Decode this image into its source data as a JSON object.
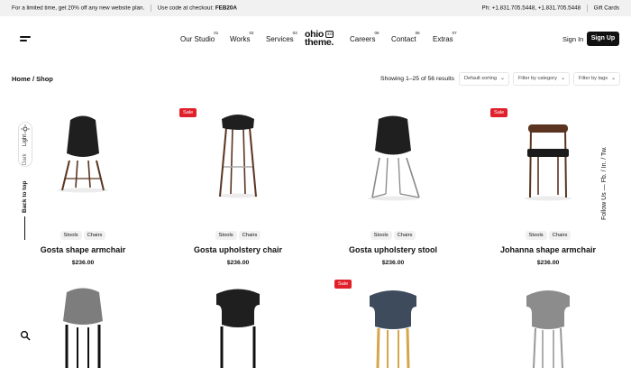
{
  "topbar": {
    "promo_text": "For a limited time, get 20% off any new website plan.",
    "code_text": "Use code at checkout:",
    "code": "FEB20A",
    "phone": "Ph: +1.831.705.5448, +1.831.705.5448",
    "gift_cards": "Gift Cards"
  },
  "nav": {
    "items": [
      {
        "label": "Our Studio",
        "num": "01"
      },
      {
        "label": "Works",
        "num": "02"
      },
      {
        "label": "Services",
        "num": "03"
      },
      {
        "label": "Careers",
        "num": "06"
      },
      {
        "label": "Contact",
        "num": "06"
      },
      {
        "label": "Extras",
        "num": "07"
      }
    ],
    "logo_line1": "ohio",
    "logo_line2": "theme.",
    "logo_version": "3.0",
    "sign_in": "Sign In",
    "sign_up": "Sign Up"
  },
  "breadcrumb": {
    "home": "Home",
    "sep": "/",
    "current": "Shop"
  },
  "toolbar": {
    "results": "Showing 1–25 of 56 results",
    "sort": "Default sorting",
    "category": "Filter by category",
    "tags": "Filter by tags"
  },
  "side": {
    "light": "Light",
    "dark": "Dark",
    "back_to_top": "Back to top",
    "follow": "Follow Us — Fb. / In. / Tw."
  },
  "products": [
    {
      "name": "Gosta shape armchair",
      "price": "$236.00",
      "tags": [
        "Stools",
        "Chairs"
      ],
      "sale": ""
    },
    {
      "name": "Gosta upholstery chair",
      "price": "$236.00",
      "tags": [
        "Stools",
        "Chairs"
      ],
      "sale": "Sale"
    },
    {
      "name": "Gosta upholstery stool",
      "price": "$236.00",
      "tags": [
        "Stools",
        "Chairs"
      ],
      "sale": ""
    },
    {
      "name": "Johanna shape armchair",
      "price": "$236.00",
      "tags": [
        "Stools",
        "Chairs"
      ],
      "sale": "Sale"
    },
    {
      "name": "",
      "price": "",
      "tags": [],
      "sale": ""
    },
    {
      "name": "",
      "price": "",
      "tags": [],
      "sale": ""
    },
    {
      "name": "",
      "price": "",
      "tags": [],
      "sale": "Sale"
    },
    {
      "name": "",
      "price": "",
      "tags": [],
      "sale": ""
    }
  ],
  "colors": {
    "accent": "#111111",
    "sale": "#e0202a",
    "topbar_bg": "#f1f1f1"
  }
}
